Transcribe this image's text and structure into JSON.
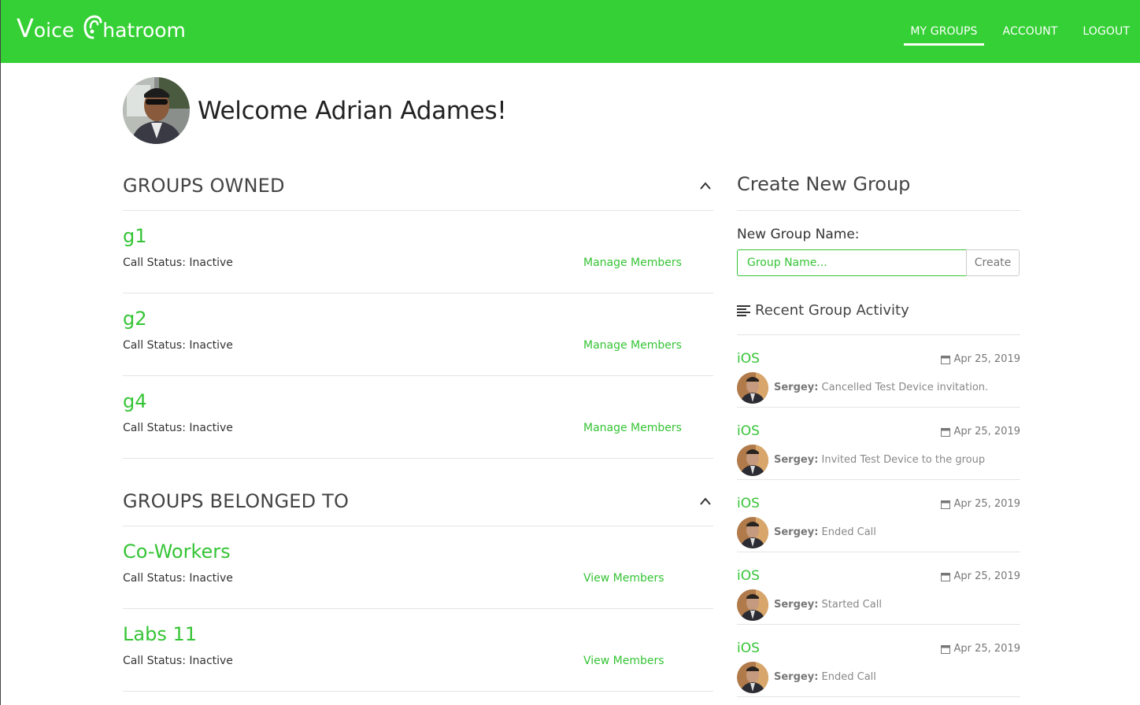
{
  "brand": {
    "first_letter": "V",
    "word1": "oice",
    "word2": "hatroom"
  },
  "nav": {
    "items": [
      {
        "label": "MY GROUPS",
        "active": true
      },
      {
        "label": "ACCOUNT",
        "active": false
      },
      {
        "label": "LOGOUT",
        "active": false
      }
    ]
  },
  "welcome": {
    "text": "Welcome Adrian Adames!"
  },
  "groups_owned": {
    "title": "GROUPS OWNED",
    "items": [
      {
        "name": "g1",
        "status": "Call Status: Inactive",
        "link": "Manage Members"
      },
      {
        "name": "g2",
        "status": "Call Status: Inactive",
        "link": "Manage Members"
      },
      {
        "name": "g4",
        "status": "Call Status: Inactive",
        "link": "Manage Members"
      }
    ]
  },
  "groups_belonged": {
    "title": "GROUPS BELONGED TO",
    "items": [
      {
        "name": "Co-Workers",
        "status": "Call Status: Inactive",
        "link": "View Members"
      },
      {
        "name": "Labs 11",
        "status": "Call Status: Inactive",
        "link": "View Members"
      }
    ]
  },
  "create": {
    "title": "Create New Group",
    "label": "New Group Name:",
    "placeholder": "Group Name...",
    "button": "Create"
  },
  "activity": {
    "title": "Recent Group Activity",
    "items": [
      {
        "group": "iOS",
        "date": "Apr 25, 2019",
        "user": "Sergey:",
        "text": "Cancelled Test Device invitation."
      },
      {
        "group": "iOS",
        "date": "Apr 25, 2019",
        "user": "Sergey:",
        "text": "Invited Test Device to the group"
      },
      {
        "group": "iOS",
        "date": "Apr 25, 2019",
        "user": "Sergey:",
        "text": "Ended Call"
      },
      {
        "group": "iOS",
        "date": "Apr 25, 2019",
        "user": "Sergey:",
        "text": "Started Call"
      },
      {
        "group": "iOS",
        "date": "Apr 25, 2019",
        "user": "Sergey:",
        "text": "Ended Call"
      }
    ]
  },
  "colors": {
    "brand_green": "#35d035",
    "link_green": "#35c435"
  },
  "icons": {
    "caret": "chevron-up-icon",
    "activity": "list-icon",
    "date": "calendar-icon",
    "logo": "ear-icon"
  }
}
